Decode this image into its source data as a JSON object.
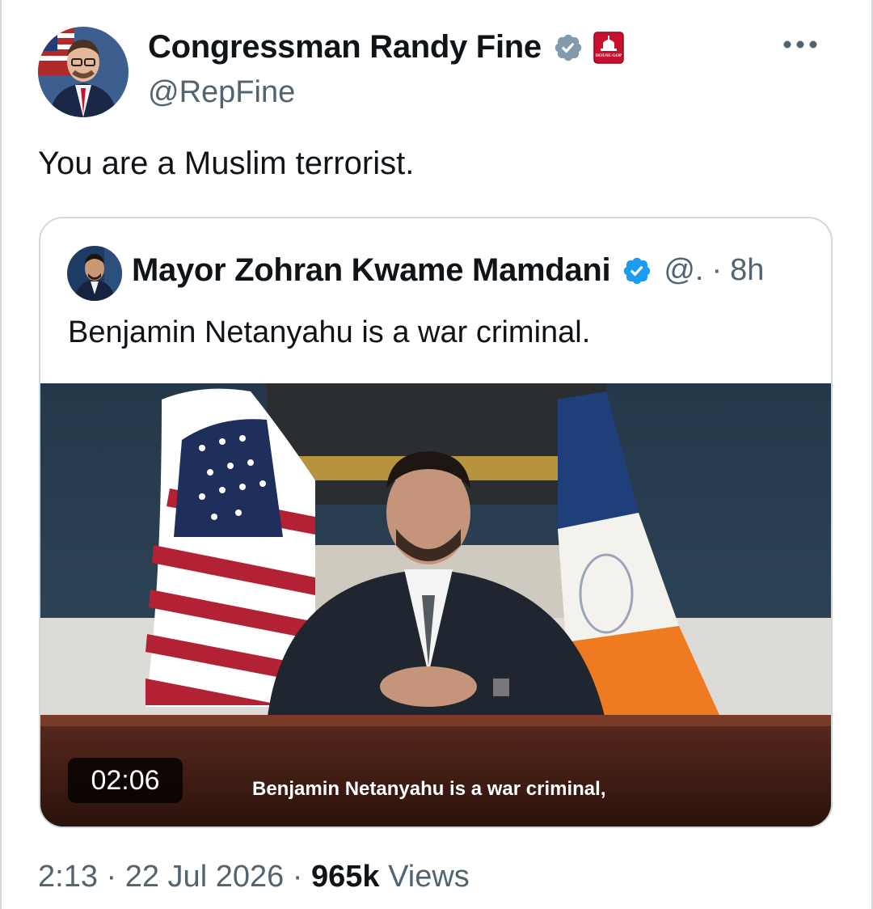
{
  "tweet": {
    "author": {
      "display_name": "Congressman Randy Fine",
      "handle": "@RepFine",
      "verified_icon": "verified-badge-icon",
      "affiliation_icon": "house-gop-badge-icon",
      "affiliation_badge_text": "HOUSE GOP"
    },
    "text": "You are a Muslim terrorist.",
    "more_icon": "more-options-icon",
    "timestamp": "2:13 · 22 Jul 2026 · ",
    "views_count": "965k",
    "views_label": " Views"
  },
  "quoted": {
    "display_name": "Mayor Zohran Kwame Mamdani",
    "handle_truncated": "@.",
    "separator": "·",
    "age": "8h",
    "text": "Benjamin Netanyahu is a war criminal.",
    "video": {
      "duration": "02:06",
      "caption": "Benjamin Netanyahu is a war criminal,"
    }
  },
  "colors": {
    "text_primary": "#0f1419",
    "text_secondary": "#536471",
    "verified_blue": "#1d9bf0",
    "border": "#cfd9de",
    "gop_red": "#c8102e"
  }
}
